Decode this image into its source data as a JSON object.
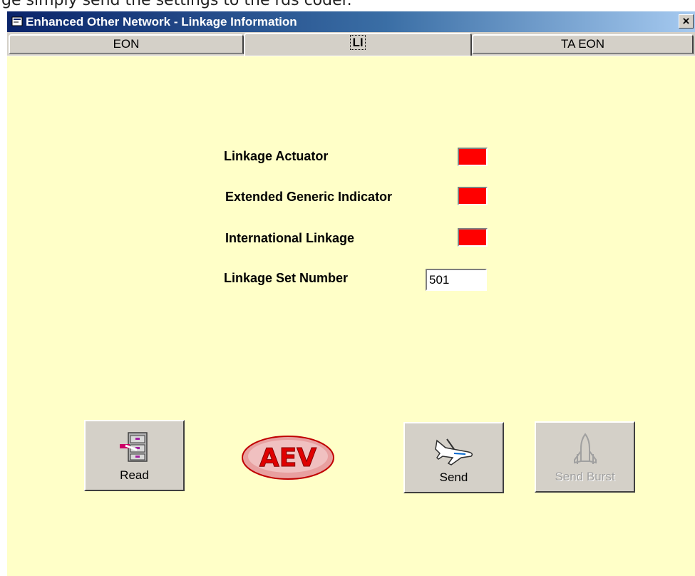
{
  "caption": "ge simply send the settings to the rds coder.",
  "window": {
    "title": "Enhanced Other Network - Linkage Information",
    "close_glyph": "×"
  },
  "tabs": [
    {
      "label": "EON",
      "active": false
    },
    {
      "label": "LI",
      "active": true
    },
    {
      "label": "TA EON",
      "active": false
    }
  ],
  "fields": {
    "linkage_actuator": {
      "label": "Linkage Actuator",
      "state_color": "#ff0000"
    },
    "extended_generic_indicator": {
      "label": "Extended Generic Indicator",
      "state_color": "#ff0000"
    },
    "international_linkage": {
      "label": "International Linkage",
      "state_color": "#ff0000"
    },
    "linkage_set_number": {
      "label": "Linkage Set Number",
      "value": "501"
    }
  },
  "buttons": {
    "read": {
      "label": "Read",
      "icon": "file-cabinet-icon"
    },
    "send": {
      "label": "Send",
      "icon": "airplane-icon"
    },
    "send_burst": {
      "label": "Send Burst",
      "icon": "space-shuttle-icon",
      "enabled": false
    }
  },
  "logo": {
    "text": "AEV"
  },
  "colors": {
    "panel_background": "#ffffc8",
    "indicator_off": "#ff0000",
    "title_bar": "#0a246a"
  }
}
